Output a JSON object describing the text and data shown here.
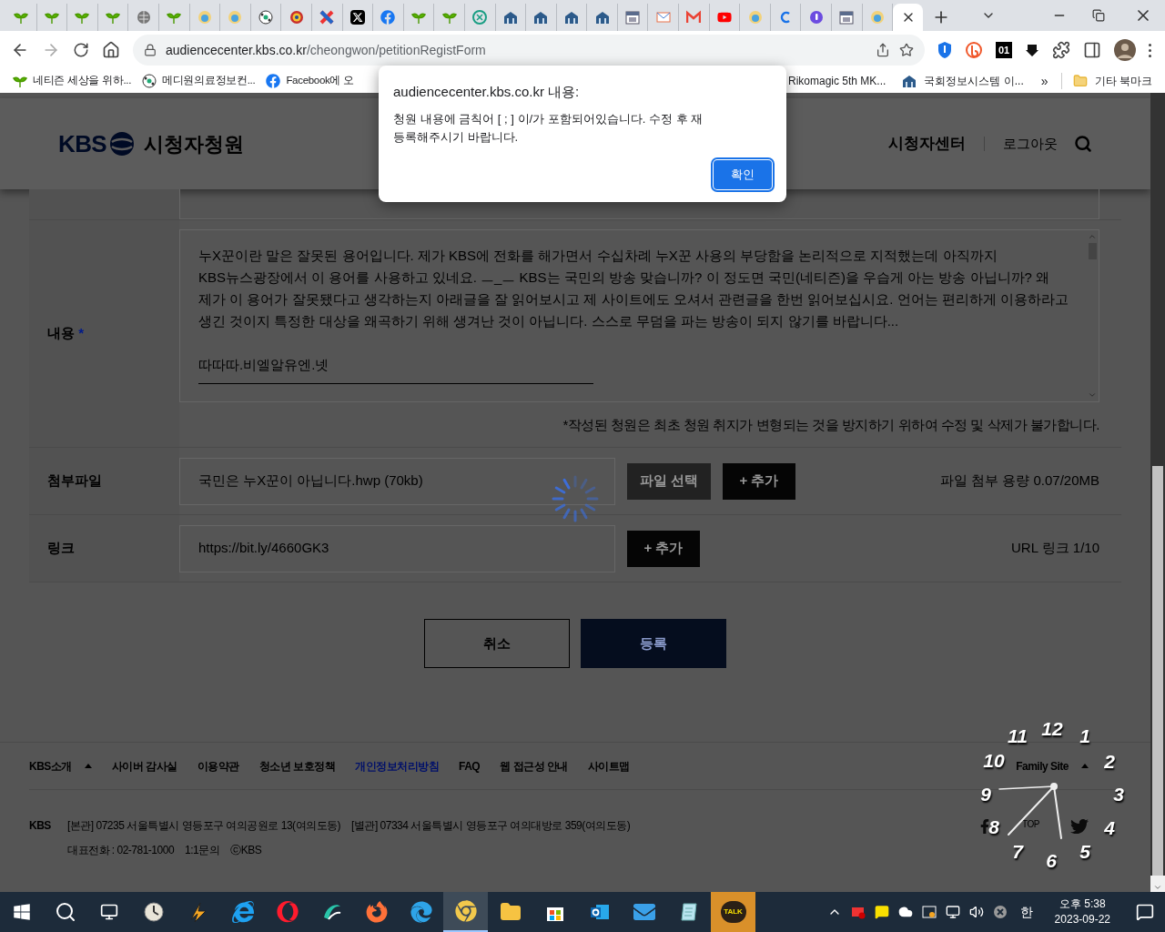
{
  "browser": {
    "tabs": [
      {
        "kind": "sprout",
        "selected": false
      },
      {
        "kind": "sprout",
        "selected": false
      },
      {
        "kind": "sprout",
        "selected": false
      },
      {
        "kind": "sprout",
        "selected": false
      },
      {
        "kind": "globe",
        "selected": false
      },
      {
        "kind": "sprout",
        "selected": false
      },
      {
        "kind": "badge",
        "selected": false
      },
      {
        "kind": "badge",
        "selected": false
      },
      {
        "kind": "ball",
        "selected": false
      },
      {
        "kind": "emblem",
        "selected": false
      },
      {
        "kind": "cross",
        "selected": false
      },
      {
        "kind": "xlogo",
        "selected": false
      },
      {
        "kind": "facebook",
        "selected": false
      },
      {
        "kind": "sprout",
        "selected": false
      },
      {
        "kind": "sprout",
        "selected": false
      },
      {
        "kind": "knot",
        "selected": false
      },
      {
        "kind": "building",
        "selected": false
      },
      {
        "kind": "building",
        "selected": false
      },
      {
        "kind": "building",
        "selected": false
      },
      {
        "kind": "building",
        "selected": false
      },
      {
        "kind": "calendar",
        "selected": false
      },
      {
        "kind": "envelope",
        "selected": false
      },
      {
        "kind": "gmail",
        "selected": false
      },
      {
        "kind": "play",
        "selected": false
      },
      {
        "kind": "badge",
        "selected": false
      },
      {
        "kind": "letter",
        "selected": false
      },
      {
        "kind": "drop",
        "selected": false
      },
      {
        "kind": "calendar",
        "selected": false
      },
      {
        "kind": "badge",
        "selected": false
      },
      {
        "selected": true
      }
    ],
    "url_host": "audiencecenter.kbs.co.kr",
    "url_path": "/cheongwon/petitionRegistForm",
    "extension_badge": "01",
    "bookmarks_left": [
      {
        "kind": "sprout",
        "label": "네티즌 세상을 위하..."
      },
      {
        "kind": "ball",
        "label": "메디원의료정보컨..."
      },
      {
        "kind": "facebook",
        "label": "Facebook에 오"
      }
    ],
    "bookmarks_right": [
      {
        "kind": "none",
        "label": "Rikomagic 5th MK..."
      },
      {
        "kind": "building",
        "label": "국회정보시스템 이..."
      }
    ],
    "bookmarks_more": "»",
    "other_bookmarks": "기타 북마크"
  },
  "header": {
    "logo": "KBS",
    "title": "시청자청원",
    "nav": [
      "시청자센터",
      "로그아웃"
    ]
  },
  "form": {
    "content_label": "내용",
    "required_mark": "*",
    "content_paragraph": "누X꾼이란 말은 잘못된 용어입니다. 제가 KBS에 전화를 해가면서 수십차례 누X꾼 사용의 부당함을 논리적으로 지적했는데 아직까지 KBS뉴스광장에서 이 용어를 사용하고 있네요. ㅡ_ㅡ KBS는 국민의 방송 맞습니까? 이 정도면 국민(네티즌)을 우습게 아는 방송 아닙니까? 왜 제가 이 용어가 잘못됐다고 생각하는지 아래글을 잘 읽어보시고 제 사이트에도 오셔서 관련글을 한번 읽어보십시요. 언어는 편리하게 이용하라고 생긴 것이지 특정한 대상을 왜곡하기 위해 생겨난 것이 아닙니다. 스스로 무덤을 파는 방송이 되지 않기를 바랍니다...",
    "content_signature": "따따따.비엘알유엔.넷",
    "content_rule": "———————————————————————————————",
    "notice": "*작성된 청원은 최초 청원 취지가 변형되는 것을 방지하기 위하여 수정 및 삭제가 불가합니다.",
    "attach_label": "첨부파일",
    "attach_value": "국민은 누X꾼이 아닙니다.hwp (70kb)",
    "attach_choose": "파일 선택",
    "attach_add": "+ 추가",
    "attach_info": "파일 첨부 용량 0.07/20MB",
    "link_label": "링크",
    "link_value": "https://bit.ly/4660GK3",
    "link_add": "+ 추가",
    "link_info": "URL 링크 1/10",
    "cancel": "취소",
    "submit": "등록"
  },
  "footer": {
    "links": [
      {
        "label": "KBS소개",
        "emphasized": false,
        "dropdown": true
      },
      {
        "label": "사이버 감사실",
        "emphasized": false,
        "dropdown": false
      },
      {
        "label": "이용약관",
        "emphasized": false,
        "dropdown": false
      },
      {
        "label": "청소년 보호정책",
        "emphasized": false,
        "dropdown": false
      },
      {
        "label": "개인정보처리방침",
        "emphasized": true,
        "dropdown": false
      },
      {
        "label": "FAQ",
        "emphasized": false,
        "dropdown": false
      },
      {
        "label": "웹 접근성 안내",
        "emphasized": false,
        "dropdown": false
      },
      {
        "label": "사이트맵",
        "emphasized": false,
        "dropdown": false
      }
    ],
    "family_site": "Family Site",
    "brand": "KBS",
    "address_main": "[본관] 07235 서울특별시 영등포구 여의공원로 13(여의도동)",
    "address_annex": "[별관] 07334 서울특별시 영등포구 여의대방로 359(여의도동)",
    "phone": "대표전화 : 02-781-1000",
    "inquiry": "1:1문의",
    "copyright": "ⓒKBS",
    "top": "TOP"
  },
  "clock": {
    "numerals": [
      "12",
      "11",
      "1",
      "10",
      "2",
      "9",
      "3",
      "8",
      "4",
      "7",
      "5",
      "6"
    ]
  },
  "dialog": {
    "title": "audiencecenter.kbs.co.kr 내용:",
    "message": "청원 내용에 금칙어 [ ; ] 이/가 포함되어있습니다. 수정 후 재 등록해주시기 바랍니다.",
    "ok": "확인"
  },
  "taskbar": {
    "apps": [
      {
        "kind": "clockapp",
        "selected": false,
        "flashing": false
      },
      {
        "kind": "winamp",
        "selected": false,
        "flashing": false
      },
      {
        "kind": "ie",
        "selected": false,
        "flashing": false
      },
      {
        "kind": "opera",
        "selected": false,
        "flashing": false
      },
      {
        "kind": "swirl",
        "selected": false,
        "flashing": false
      },
      {
        "kind": "firefox",
        "selected": false,
        "flashing": false
      },
      {
        "kind": "edge",
        "selected": false,
        "flashing": false
      },
      {
        "kind": "chrome",
        "selected": true,
        "flashing": false
      },
      {
        "kind": "folder",
        "selected": false,
        "flashing": false
      },
      {
        "kind": "store",
        "selected": false,
        "flashing": false
      },
      {
        "kind": "outlook",
        "selected": false,
        "flashing": false
      },
      {
        "kind": "mail",
        "selected": false,
        "flashing": false
      },
      {
        "kind": "notepad",
        "selected": false,
        "flashing": false
      },
      {
        "kind": "talk",
        "selected": false,
        "flashing": true
      }
    ],
    "talk_label": "TALK",
    "ime": "한",
    "time": "오후 5:38",
    "date": "2023-09-22"
  }
}
